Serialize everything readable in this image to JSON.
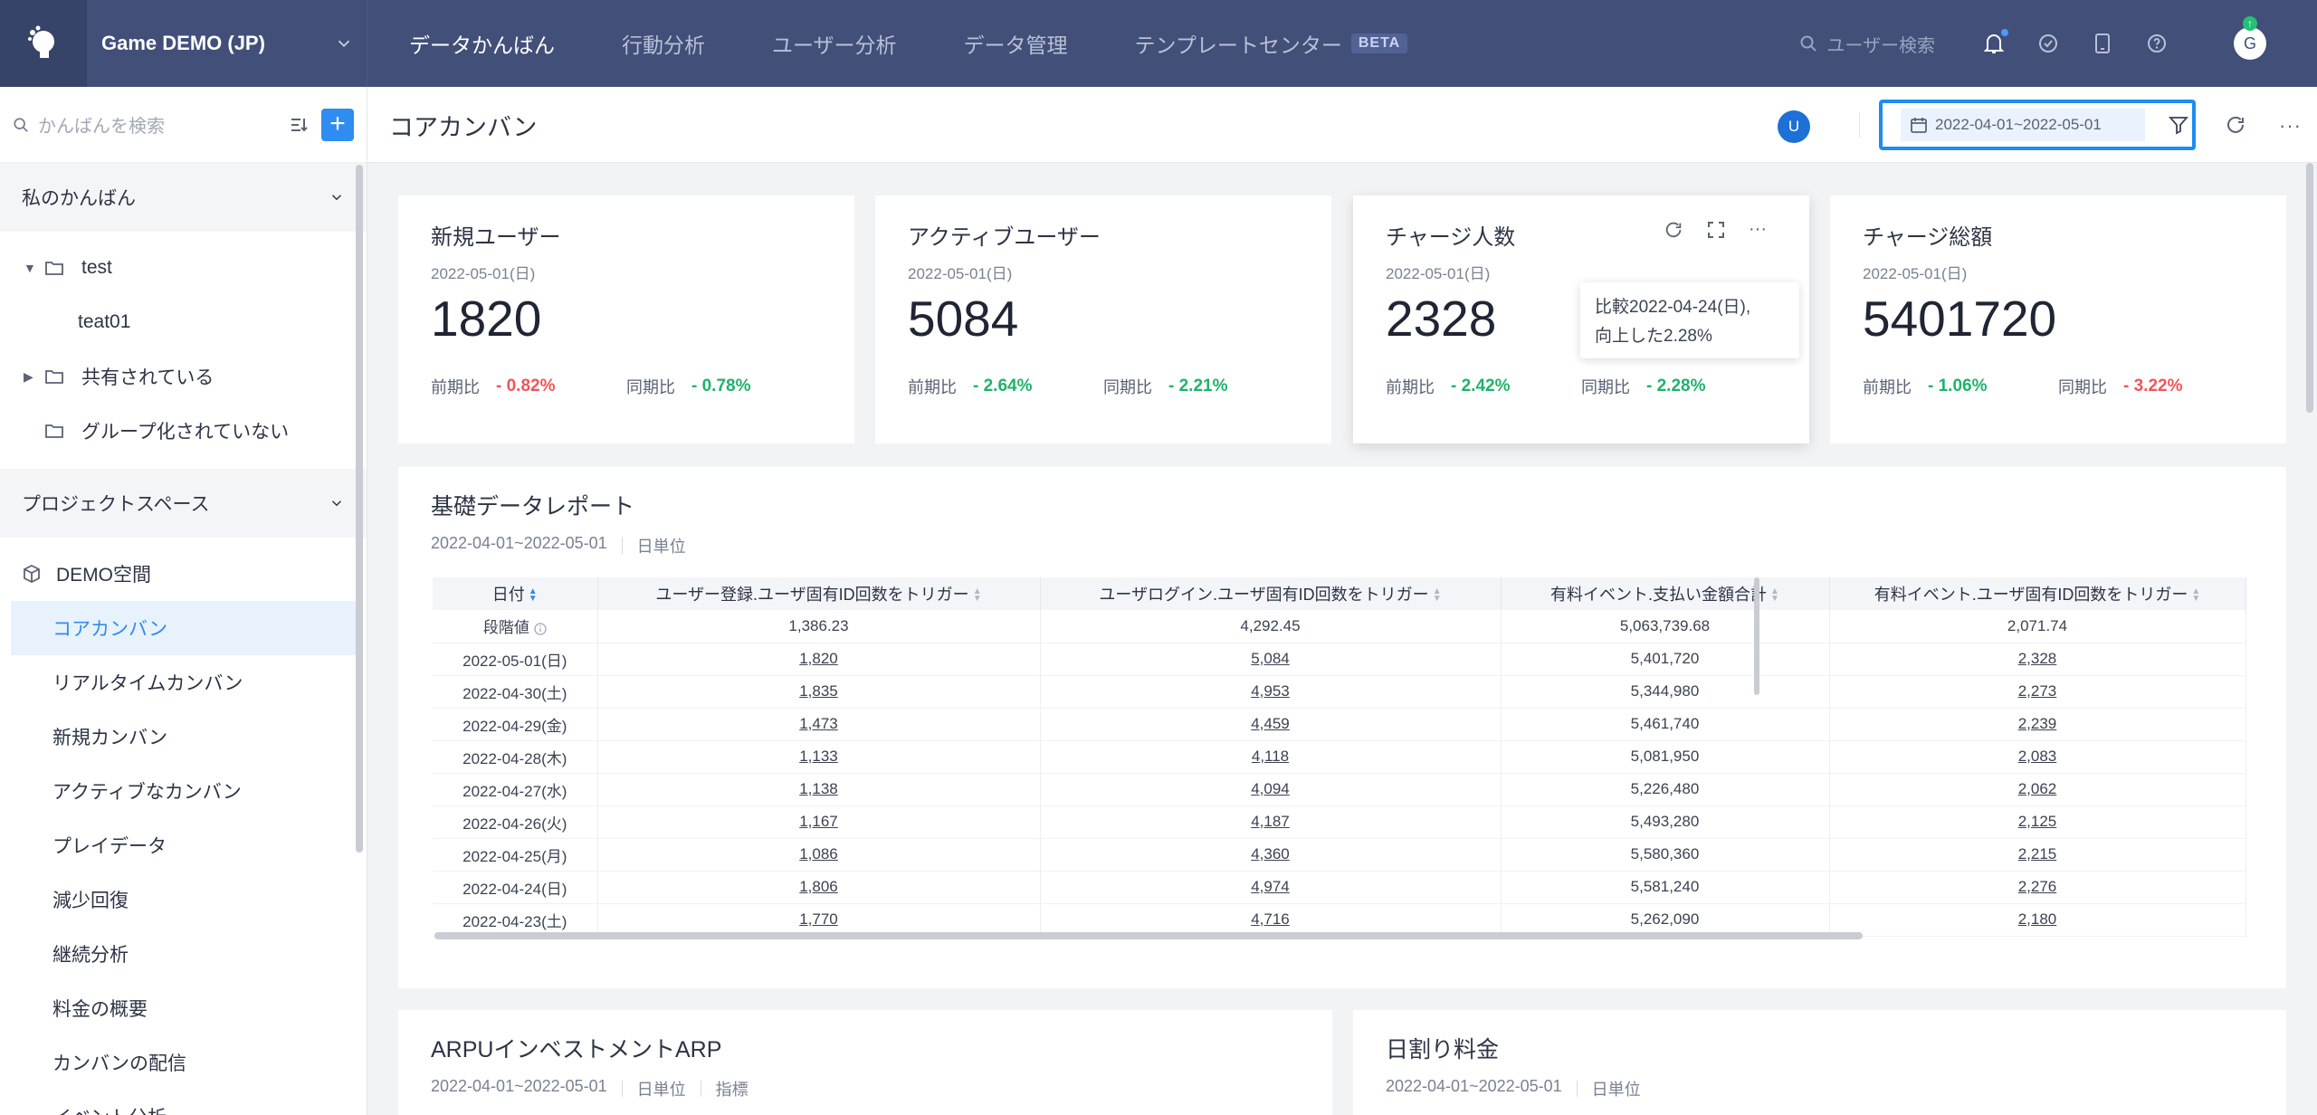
{
  "app": {
    "project_name": "Game DEMO (JP)",
    "nav": [
      {
        "label": "データかんばん",
        "active": true
      },
      {
        "label": "行動分析"
      },
      {
        "label": "ユーザー分析"
      },
      {
        "label": "データ管理"
      },
      {
        "label": "テンプレートセンター",
        "badge": "BETA"
      }
    ],
    "user_search_placeholder": "ユーザー検索",
    "avatar_initial": "G",
    "accent": "#2f8cf0",
    "topbar_color": "#414f79"
  },
  "sidebar": {
    "search_placeholder": "かんばんを検索",
    "add_label": "+",
    "my_section": "私のかんばん",
    "my_items": [
      {
        "label": "test",
        "type": "folder",
        "expanded": true
      },
      {
        "label": "teat01",
        "type": "board"
      },
      {
        "label": "共有されている",
        "type": "folder",
        "expanded": false
      },
      {
        "label": "グループ化されていない",
        "type": "folder"
      }
    ],
    "project_section": "プロジェクトスペース",
    "space_name": "DEMO空間",
    "boards": [
      {
        "label": "コアカンバン",
        "active": true
      },
      {
        "label": "リアルタイムカンバン"
      },
      {
        "label": "新規カンバン"
      },
      {
        "label": "アクティブなカンバン"
      },
      {
        "label": "プレイデータ"
      },
      {
        "label": "減少回復"
      },
      {
        "label": "継続分析"
      },
      {
        "label": "料金の概要"
      },
      {
        "label": "カンバンの配信"
      },
      {
        "label": "イベント分析"
      }
    ]
  },
  "header": {
    "title": "コアカンバン",
    "user_initial": "U",
    "date_range": "2022-04-01~2022-05-01"
  },
  "kpis": [
    {
      "title": "新規ユーザー",
      "date": "2022-05-01(日)",
      "value": "1820",
      "prev_label": "前期比",
      "prev_value": "0.82%",
      "prev_trend": "down",
      "yoy_label": "同期比",
      "yoy_value": "0.78%",
      "yoy_trend": "up"
    },
    {
      "title": "アクティブユーザー",
      "date": "2022-05-01(日)",
      "value": "5084",
      "prev_label": "前期比",
      "prev_value": "2.64%",
      "prev_trend": "up",
      "yoy_label": "同期比",
      "yoy_value": "2.21%",
      "yoy_trend": "up"
    },
    {
      "title": "チャージ人数",
      "date": "2022-05-01(日)",
      "value": "2328",
      "prev_label": "前期比",
      "prev_value": "2.42%",
      "prev_trend": "up",
      "yoy_label": "同期比",
      "yoy_value": "2.28%",
      "yoy_trend": "up"
    },
    {
      "title": "チャージ総額",
      "date": "2022-05-01(日)",
      "value": "5401720",
      "prev_label": "前期比",
      "prev_value": "1.06%",
      "prev_trend": "up",
      "yoy_label": "同期比",
      "yoy_value": "3.22%",
      "yoy_trend": "down"
    }
  ],
  "tooltip": {
    "line1": "比較2022-04-24(日),",
    "line2": "向上した2.28%"
  },
  "report": {
    "title": "基礎データレポート",
    "range": "2022-04-01~2022-05-01",
    "granularity": "日単位",
    "columns": [
      "日付",
      "ユーザー登録.ユーザ固有ID回数をトリガー",
      "ユーザログイン.ユーザ固有ID回数をトリガー",
      "有料イベント.支払い金額合計",
      "有料イベント.ユーザ固有ID回数をトリガー"
    ],
    "stage_label": "段階値",
    "stage_values": [
      "1,386.23",
      "4,292.45",
      "5,063,739.68",
      "2,071.74"
    ],
    "rows": [
      [
        "2022-05-01(日)",
        "1,820",
        "5,084",
        "5,401,720",
        "2,328"
      ],
      [
        "2022-04-30(土)",
        "1,835",
        "4,953",
        "5,344,980",
        "2,273"
      ],
      [
        "2022-04-29(金)",
        "1,473",
        "4,459",
        "5,461,740",
        "2,239"
      ],
      [
        "2022-04-28(木)",
        "1,133",
        "4,118",
        "5,081,950",
        "2,083"
      ],
      [
        "2022-04-27(水)",
        "1,138",
        "4,094",
        "5,226,480",
        "2,062"
      ],
      [
        "2022-04-26(火)",
        "1,167",
        "4,187",
        "5,493,280",
        "2,125"
      ],
      [
        "2022-04-25(月)",
        "1,086",
        "4,360",
        "5,580,360",
        "2,215"
      ],
      [
        "2022-04-24(日)",
        "1,806",
        "4,974",
        "5,581,240",
        "2,276"
      ],
      [
        "2022-04-23(土)",
        "1,770",
        "4,716",
        "5,262,090",
        "2,180"
      ]
    ]
  },
  "bottom_cards": [
    {
      "title": "ARPUインベストメントARP",
      "range": "2022-04-01~2022-05-01",
      "granularity": "日単位",
      "extra": "指標"
    },
    {
      "title": "日割り料金",
      "range": "2022-04-01~2022-05-01",
      "granularity": "日単位"
    }
  ]
}
